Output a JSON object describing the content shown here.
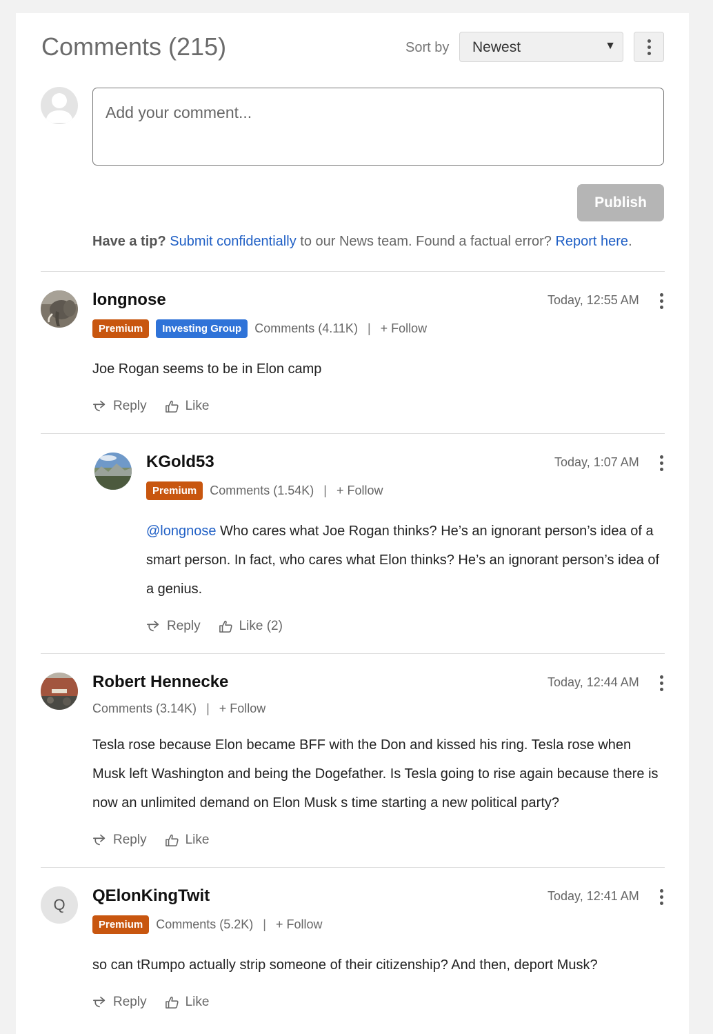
{
  "header": {
    "title": "Comments (215)",
    "sort_label": "Sort by",
    "sort_value": "Newest"
  },
  "composer": {
    "placeholder": "Add your comment...",
    "publish_label": "Publish"
  },
  "tip": {
    "lead": "Have a tip?",
    "link1": "Submit confidentially",
    "mid": " to our News team. Found a factual error? ",
    "link2": "Report here",
    "end": "."
  },
  "colors": {
    "premium": "#c8560f",
    "investing_group": "#2f73d8",
    "link": "#1f5fc5",
    "publish_disabled": "#b5b5b5"
  },
  "comments": [
    {
      "user": "longnose",
      "time": "Today, 12:55 AM",
      "badges": [
        "Premium",
        "Investing Group"
      ],
      "comments_count": "Comments (4.11K)",
      "follow": "+ Follow",
      "text": "Joe Rogan seems to be in Elon camp",
      "reply_label": "Reply",
      "like_label": "Like",
      "avatar": "elephant-photo"
    },
    {
      "user": "KGold53",
      "time": "Today, 1:07 AM",
      "badges": [
        "Premium"
      ],
      "comments_count": "Comments (1.54K)",
      "follow": "+ Follow",
      "mention": "@longnose",
      "text": " Who cares what Joe Rogan thinks? He’s an ignorant person’s idea of a smart person. In fact, who cares what Elon thinks? He’s an ignorant person’s idea of a genius.",
      "reply_label": "Reply",
      "like_label": "Like (2)",
      "avatar": "landscape-photo"
    },
    {
      "user": "Robert Hennecke",
      "time": "Today, 12:44 AM",
      "badges": [],
      "comments_count": "Comments (3.14K)",
      "follow": "+ Follow",
      "text": "Tesla rose because Elon became BFF with the Don and kissed his ring. Tesla rose when Musk left Washington and being the Dogefather. Is Tesla going to rise again because there is now an unlimited demand on Elon Musk s time starting a new political party?",
      "reply_label": "Reply",
      "like_label": "Like",
      "avatar": "building-photo"
    },
    {
      "user": "QElonKingTwit",
      "time": "Today, 12:41 AM",
      "badges": [
        "Premium"
      ],
      "comments_count": "Comments (5.2K)",
      "follow": "+ Follow",
      "text": "so can tRumpo actually strip someone of their citizenship? And then, deport Musk?",
      "reply_label": "Reply",
      "like_label": "Like",
      "avatar_letter": "Q"
    }
  ]
}
